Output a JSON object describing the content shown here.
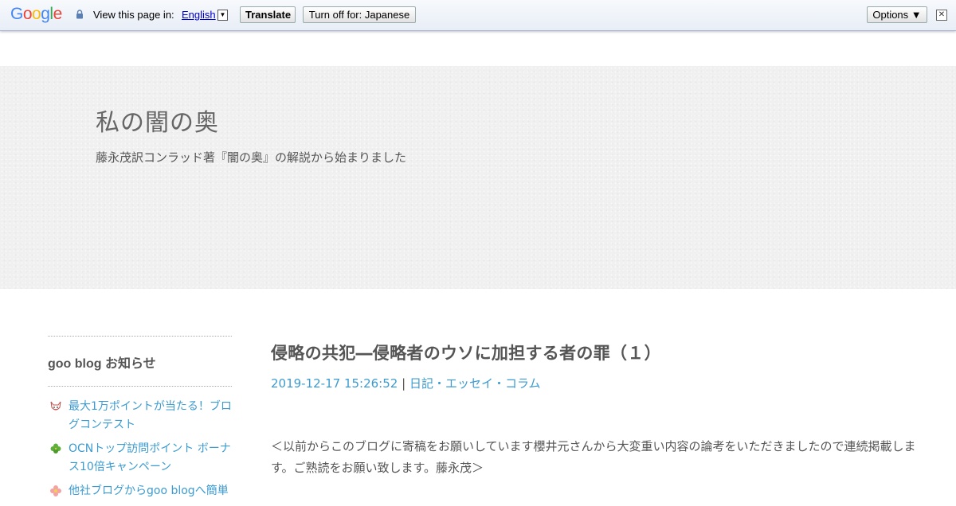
{
  "translate_bar": {
    "logo": "Google",
    "view_text": "View this page in:",
    "language": "English",
    "translate_label": "Translate",
    "turnoff_label": "Turn off for: Japanese",
    "options_label": "Options ▼",
    "close_label": "✕",
    "dropdown_glyph": "▼"
  },
  "header": {
    "title": "私の闇の奥",
    "description": "藤永茂訳コンラッド著『闇の奥』の解説から始まりました"
  },
  "sidebar": {
    "heading": "goo blog お知らせ",
    "items": [
      {
        "label": "最大1万ポイントが当たる！ブログコンテスト",
        "icon": "fox-icon"
      },
      {
        "label": "OCNトップ訪問ポイント ボーナス10倍キャンペーン",
        "icon": "clover-icon"
      },
      {
        "label": "他社ブログからgoo blogへ簡単",
        "icon": "flower-icon"
      }
    ]
  },
  "post": {
    "title": "侵略の共犯―侵略者のウソに加担する者の罪（１）",
    "date": "2019-12-17 15:26:52",
    "separator": "|",
    "category": "日記・エッセイ・コラム",
    "body": "＜以前からこのブログに寄稿をお願いしています櫻井元さんから大変重い内容の論考をいただきましたので連続掲載します。ご熟読をお願い致します。藤永茂＞"
  },
  "colors": {
    "link": "#3c9bd0",
    "text": "#555555",
    "banner": "#f0f0f0"
  }
}
